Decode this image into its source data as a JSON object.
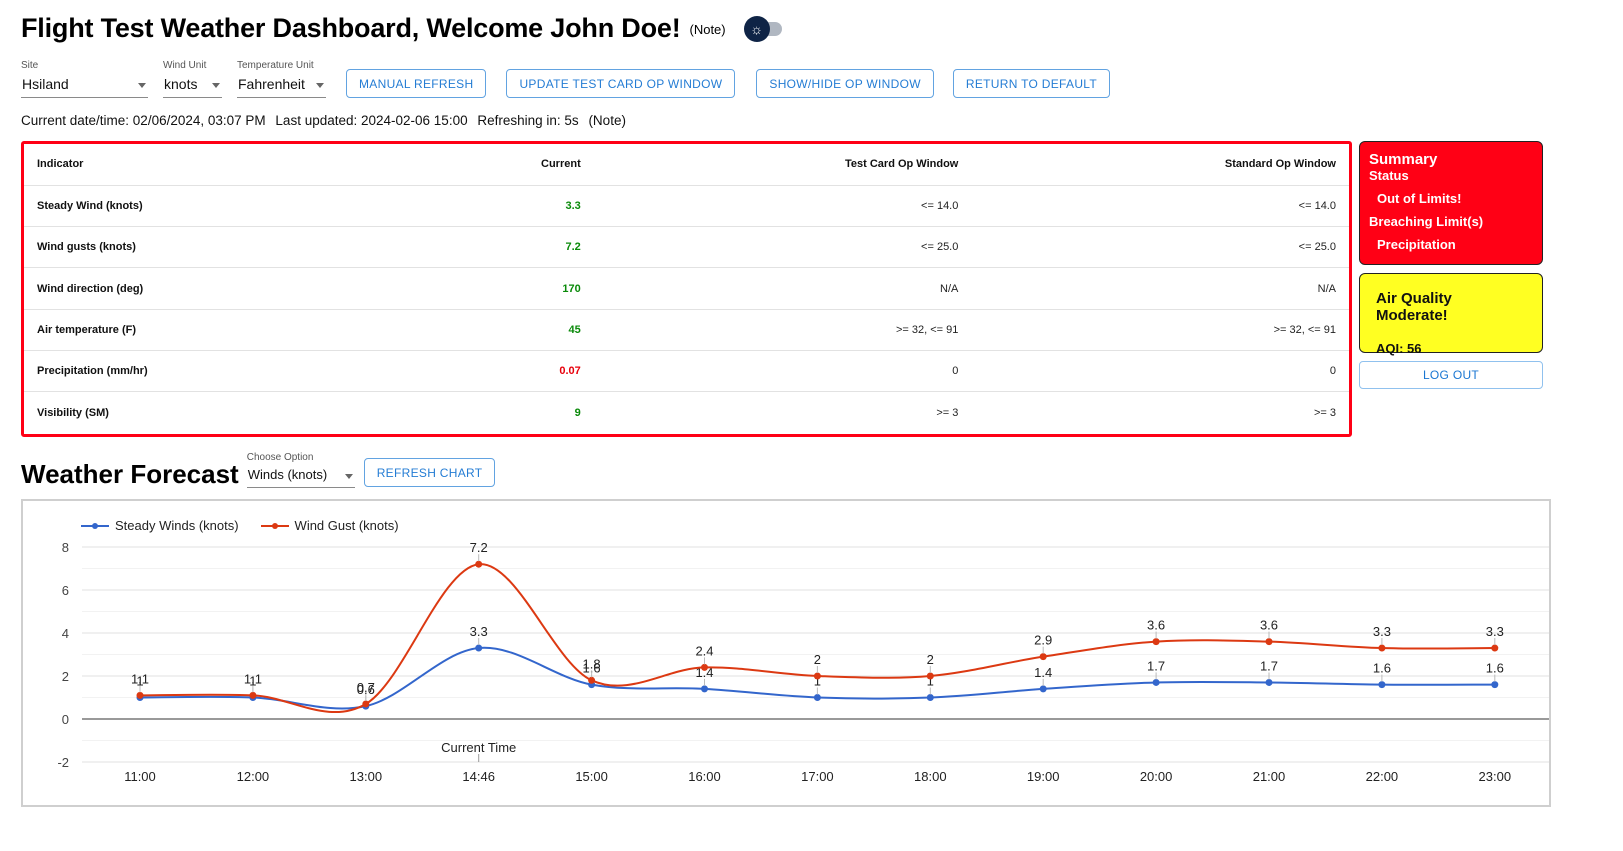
{
  "header": {
    "title": "Flight Test Weather Dashboard, Welcome John Doe!",
    "note": "(Note)",
    "theme_toggle_icon": "sun-icon"
  },
  "controls": {
    "site": {
      "label": "Site",
      "value": "Hsiland"
    },
    "wind_unit": {
      "label": "Wind Unit",
      "value": "knots"
    },
    "temp_unit": {
      "label": "Temperature Unit",
      "value": "Fahrenheit"
    },
    "buttons": {
      "manual_refresh": "MANUAL REFRESH",
      "update_test_card": "UPDATE TEST CARD OP WINDOW",
      "show_hide": "SHOW/HIDE OP WINDOW",
      "return_default": "RETURN TO DEFAULT"
    }
  },
  "status": {
    "current_datetime": "Current date/time: 02/06/2024, 03:07 PM",
    "last_updated": "Last updated: 2024-02-06 15:00",
    "refreshing": "Refreshing in: 5s",
    "note": "(Note)"
  },
  "table": {
    "headers": [
      "Indicator",
      "Current",
      "Test Card Op Window",
      "Standard Op Window"
    ],
    "rows": [
      {
        "indicator": "Steady Wind (knots)",
        "current": "3.3",
        "status": "ok",
        "test_card": "<= 14.0",
        "standard": "<= 14.0"
      },
      {
        "indicator": "Wind gusts (knots)",
        "current": "7.2",
        "status": "ok",
        "test_card": "<= 25.0",
        "standard": "<= 25.0"
      },
      {
        "indicator": "Wind direction (deg)",
        "current": "170",
        "status": "ok",
        "test_card": "N/A",
        "standard": "N/A"
      },
      {
        "indicator": "Air temperature (F)",
        "current": "45",
        "status": "ok",
        "test_card": ">= 32, <= 91",
        "standard": ">= 32, <= 91"
      },
      {
        "indicator": "Precipitation (mm/hr)",
        "current": "0.07",
        "status": "bad",
        "test_card": "0",
        "standard": "0"
      },
      {
        "indicator": "Visibility (SM)",
        "current": "9",
        "status": "ok",
        "test_card": ">= 3",
        "standard": ">= 3"
      }
    ]
  },
  "summary": {
    "title": "Summary",
    "status_label": "Status",
    "status_value": "Out of Limits!",
    "breaching_label": "Breaching Limit(s)",
    "breaching_value": "Precipitation",
    "color": "#ff0015"
  },
  "air_quality": {
    "title": "Air Quality Moderate!",
    "aqi": "AQI: 56",
    "color": "#ffff22"
  },
  "logout_label": "LOG OUT",
  "forecast": {
    "title": "Weather Forecast",
    "option_label": "Choose Option",
    "option_value": "Winds (knots)",
    "refresh_label": "REFRESH CHART"
  },
  "chart_data": {
    "type": "line",
    "title": "",
    "xlabel": "",
    "ylabel": "",
    "categories": [
      "11:00",
      "12:00",
      "13:00",
      "14:46",
      "15:00",
      "16:00",
      "17:00",
      "18:00",
      "19:00",
      "20:00",
      "21:00",
      "22:00",
      "23:00"
    ],
    "series": [
      {
        "name": "Steady Winds (knots)",
        "color": "#3366cc",
        "values": [
          1,
          1,
          0.6,
          3.3,
          1.6,
          1.4,
          1,
          1,
          1.4,
          1.7,
          1.7,
          1.6,
          1.6
        ]
      },
      {
        "name": "Wind Gust (knots)",
        "color": "#dc3912",
        "values": [
          1.1,
          1.1,
          0.7,
          7.2,
          1.8,
          2.4,
          2,
          2,
          2.9,
          3.6,
          3.6,
          3.3,
          3.3
        ]
      }
    ],
    "ylim": [
      -2,
      8
    ],
    "yticks": [
      -2,
      0,
      2,
      4,
      6,
      8
    ],
    "grid": true,
    "legend": "top-left",
    "annotation": {
      "category": "14:46",
      "text": "Current Time"
    },
    "curve": "smooth"
  }
}
